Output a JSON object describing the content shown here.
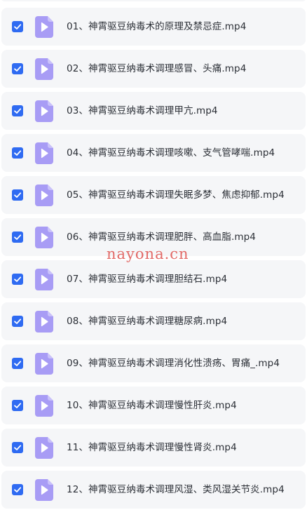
{
  "files": [
    {
      "name": "01、神霄驱豆纳毒术的原理及禁忌症.mp4",
      "checked": true,
      "icon": "video-file-icon"
    },
    {
      "name": "02、神霄驱豆纳毒术调理感冒、头痛.mp4",
      "checked": true,
      "icon": "video-file-icon"
    },
    {
      "name": "03、神霄驱豆纳毒术调理甲亢.mp4",
      "checked": true,
      "icon": "video-file-icon"
    },
    {
      "name": "04、神霄驱豆纳毒术调理咳嗽、支气管哮喘.mp4",
      "checked": true,
      "icon": "video-file-icon"
    },
    {
      "name": "05、神霄驱豆纳毒术调理失眠多梦、焦虑抑郁.mp4",
      "checked": true,
      "icon": "video-file-icon"
    },
    {
      "name": "06、神霄驱豆纳毒术调理肥胖、高血脂.mp4",
      "checked": true,
      "icon": "video-file-icon"
    },
    {
      "name": "07、神霄驱豆纳毒术调理胆结石.mp4",
      "checked": true,
      "icon": "video-file-icon"
    },
    {
      "name": "08、神霄驱豆纳毒术调理糖尿病.mp4",
      "checked": true,
      "icon": "video-file-icon"
    },
    {
      "name": "09、神霄驱豆纳毒术调理消化性溃疡、胃痛_.mp4",
      "checked": true,
      "icon": "video-file-icon"
    },
    {
      "name": "10、神霄驱豆纳毒术调理慢性肝炎.mp4",
      "checked": true,
      "icon": "video-file-icon"
    },
    {
      "name": "11、神霄驱豆纳毒术调理慢性肾炎.mp4",
      "checked": true,
      "icon": "video-file-icon"
    },
    {
      "name": "12、神霄驱豆纳毒术调理风湿、类风湿关节炎.mp4",
      "checked": true,
      "icon": "video-file-icon"
    }
  ],
  "watermark": "nayona.cn",
  "colors": {
    "row_background": "#f5f6f8",
    "checkbox": "#2f6bf2",
    "file_icon": "#a89cf5",
    "text": "#2b2f36",
    "watermark": "#e05a57"
  }
}
